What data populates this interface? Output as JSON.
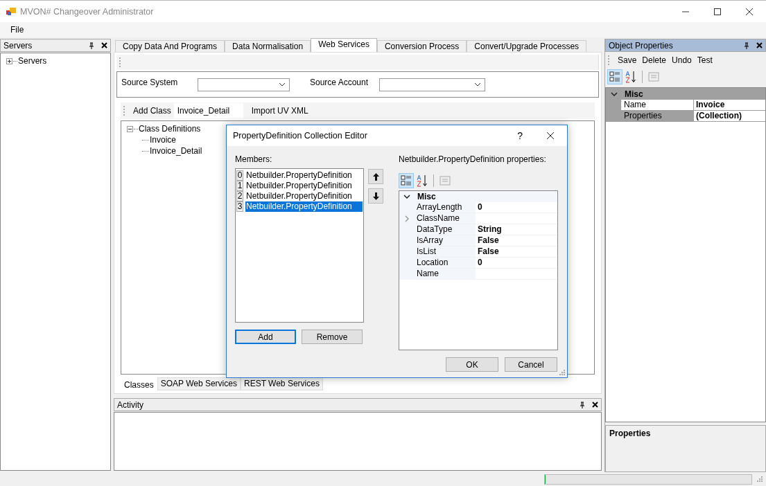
{
  "window": {
    "title": "MVON# Changeover Administrator"
  },
  "menu": [
    "File"
  ],
  "servers_panel": {
    "title": "Servers",
    "tree": [
      {
        "label": "Servers",
        "expanded": false
      }
    ]
  },
  "main_tabs": [
    {
      "label": "Copy Data And Programs",
      "selected": false
    },
    {
      "label": "Data Normalisation",
      "selected": false
    },
    {
      "label": "Web Services",
      "selected": true
    },
    {
      "label": "Conversion Process",
      "selected": false
    },
    {
      "label": "Convert/Upgrade Processes",
      "selected": false
    }
  ],
  "source": {
    "system_label": "Source System",
    "account_label": "Source Account"
  },
  "class_toolbar": {
    "add_button": "Add Class",
    "class_field": "Invoice_Detail",
    "import_button": "Import UV XML"
  },
  "class_tree": [
    {
      "label": "Class Definitions",
      "expanded": true,
      "children": [
        {
          "label": "Invoice"
        },
        {
          "label": "Invoice_Detail"
        }
      ]
    }
  ],
  "bottom_tabs": [
    {
      "label": "Classes",
      "selected": true
    },
    {
      "label": "SOAP Web Services",
      "selected": false
    },
    {
      "label": "REST Web Services",
      "selected": false
    }
  ],
  "activity_panel": {
    "title": "Activity"
  },
  "object_properties": {
    "title": "Object Properties",
    "toolbar": [
      "Save",
      "Delete",
      "Undo",
      "Test"
    ],
    "category": "Misc",
    "rows": [
      {
        "name": "Name",
        "value": "Invoice",
        "selected": false
      },
      {
        "name": "Properties",
        "value": "(Collection)",
        "selected": true
      }
    ],
    "description_title": "Properties"
  },
  "dialog": {
    "title": "PropertyDefinition Collection Editor",
    "help": "?",
    "members_label": "Members:",
    "members": [
      {
        "index": "0",
        "label": "Netbuilder.PropertyDefinition",
        "selected": false
      },
      {
        "index": "1",
        "label": "Netbuilder.PropertyDefinition",
        "selected": false
      },
      {
        "index": "2",
        "label": "Netbuilder.PropertyDefinition",
        "selected": false
      },
      {
        "index": "3",
        "label": "Netbuilder.PropertyDefinition",
        "selected": true
      }
    ],
    "properties_label": "Netbuilder.PropertyDefinition properties:",
    "category": "Misc",
    "properties": [
      {
        "name": "ArrayLength",
        "value": "0",
        "expandable": false
      },
      {
        "name": "ClassName",
        "expandable": true
      },
      {
        "name": "DataType",
        "value": "String",
        "expandable": false
      },
      {
        "name": "IsArray",
        "value": "False",
        "expandable": false
      },
      {
        "name": "IsList",
        "value": "False",
        "expandable": false
      },
      {
        "name": "Location",
        "value": "0",
        "expandable": false
      },
      {
        "name": "Name",
        "expandable": false
      }
    ],
    "buttons": [
      {
        "label": "Add",
        "kind": "default"
      },
      {
        "label": "Remove",
        "kind": "normal"
      }
    ],
    "footer_buttons": [
      "OK",
      "Cancel"
    ]
  },
  "status_bar": {
    "progress": {
      "level": 0
    }
  }
}
